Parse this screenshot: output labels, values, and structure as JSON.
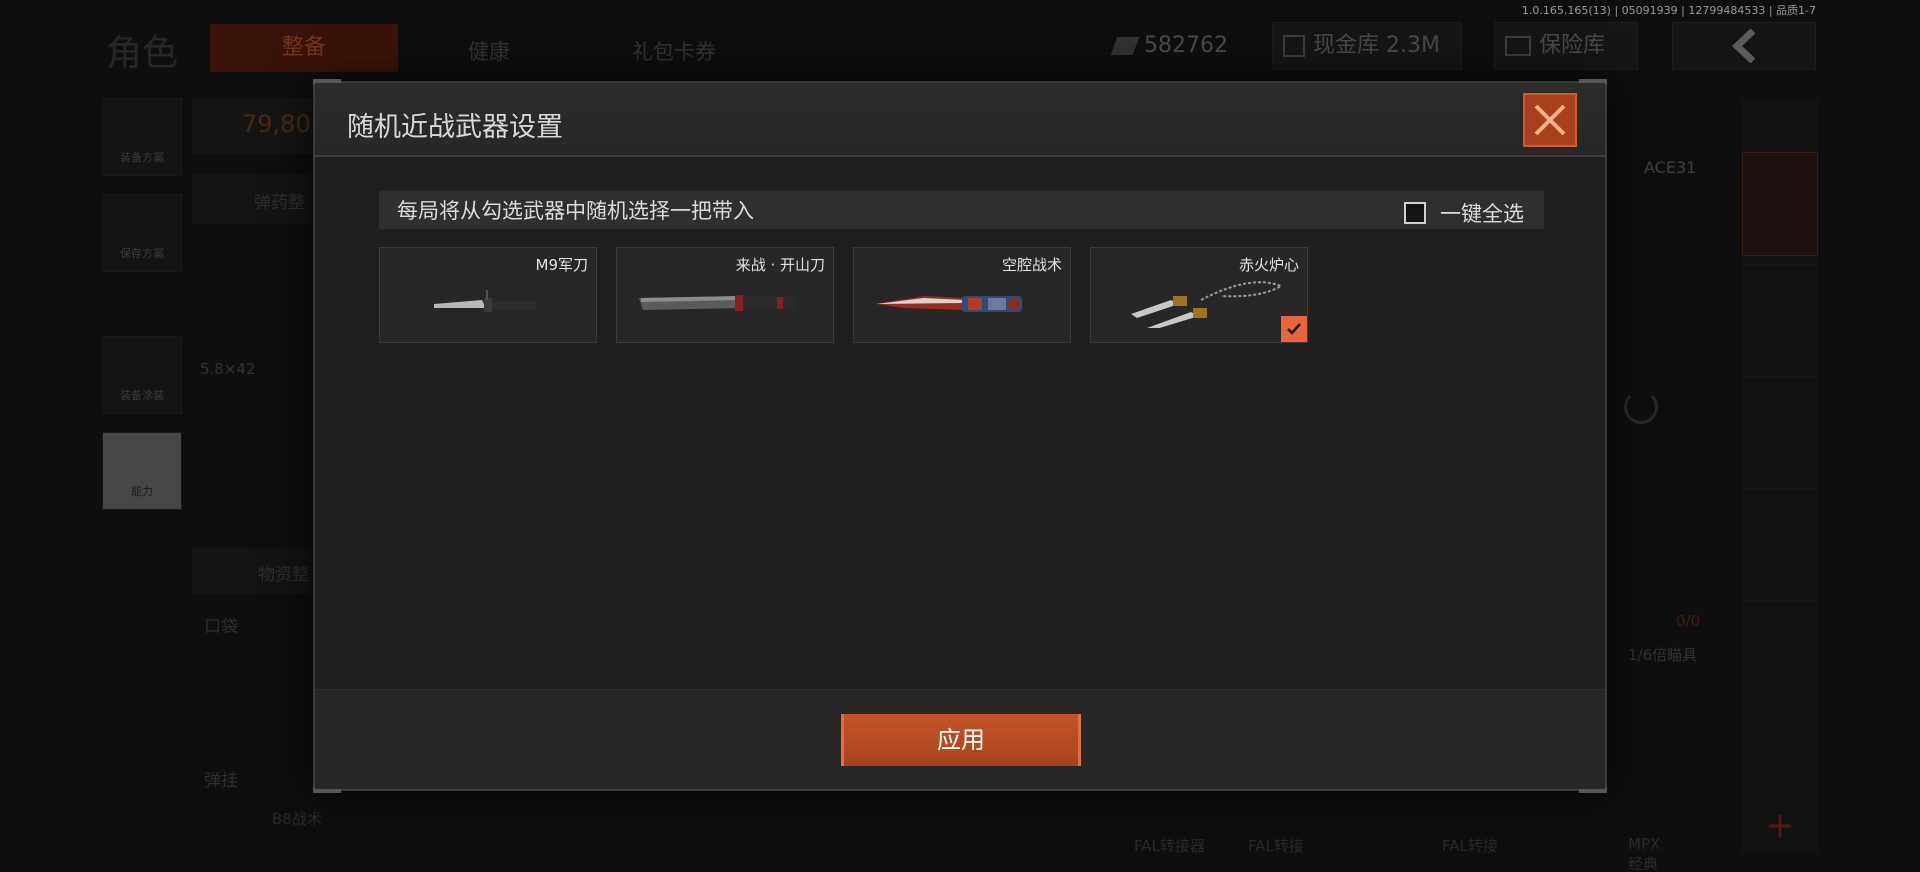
{
  "version_info": "1.0.165.165(13) | 05091939 | 12799484533 | 品质1-7",
  "background": {
    "page_title": "角色",
    "tabs": [
      {
        "label": "整备",
        "active": true
      },
      {
        "label": "健康",
        "active": false
      },
      {
        "label": "礼包卡券",
        "active": false
      }
    ],
    "currency": "582762",
    "cash_vault": "现金库 2.3M",
    "safe_box": "保险库",
    "side_buttons": [
      {
        "label": "装备方案"
      },
      {
        "label": "保存方案"
      },
      {
        "label": "装备涂装"
      },
      {
        "label": "能力"
      }
    ],
    "armor_value": "79,80",
    "ammo_label": "弹药整",
    "caliber": "5.8×42",
    "supplies_label": "物资整",
    "pocket_label": "口袋",
    "hanger_label": "弹挂",
    "hanger_item": "B8战术",
    "weapon_name": "ACE31",
    "ammo_count": "0/0",
    "scope": "1/6倍瞄具",
    "bottom_labels": [
      "FAL转接器",
      "FAL转接",
      "FAL转接",
      "MPX经典"
    ]
  },
  "modal": {
    "title": "随机近战武器设置",
    "info": "每局将从勾选武器中随机选择一把带入",
    "select_all": "一键全选",
    "select_all_checked": false,
    "weapons": [
      {
        "name": "M9军刀",
        "checked": false,
        "icon": "bayonet-icon"
      },
      {
        "name": "来战 · 开山刀",
        "checked": false,
        "icon": "machete-icon"
      },
      {
        "name": "空腔战术",
        "checked": false,
        "icon": "tactical-knife-icon"
      },
      {
        "name": "赤火炉心",
        "checked": true,
        "icon": "rope-dart-icon"
      }
    ],
    "apply": "应用"
  },
  "colors": {
    "accent": "#c4502a",
    "check": "#e8643a"
  }
}
